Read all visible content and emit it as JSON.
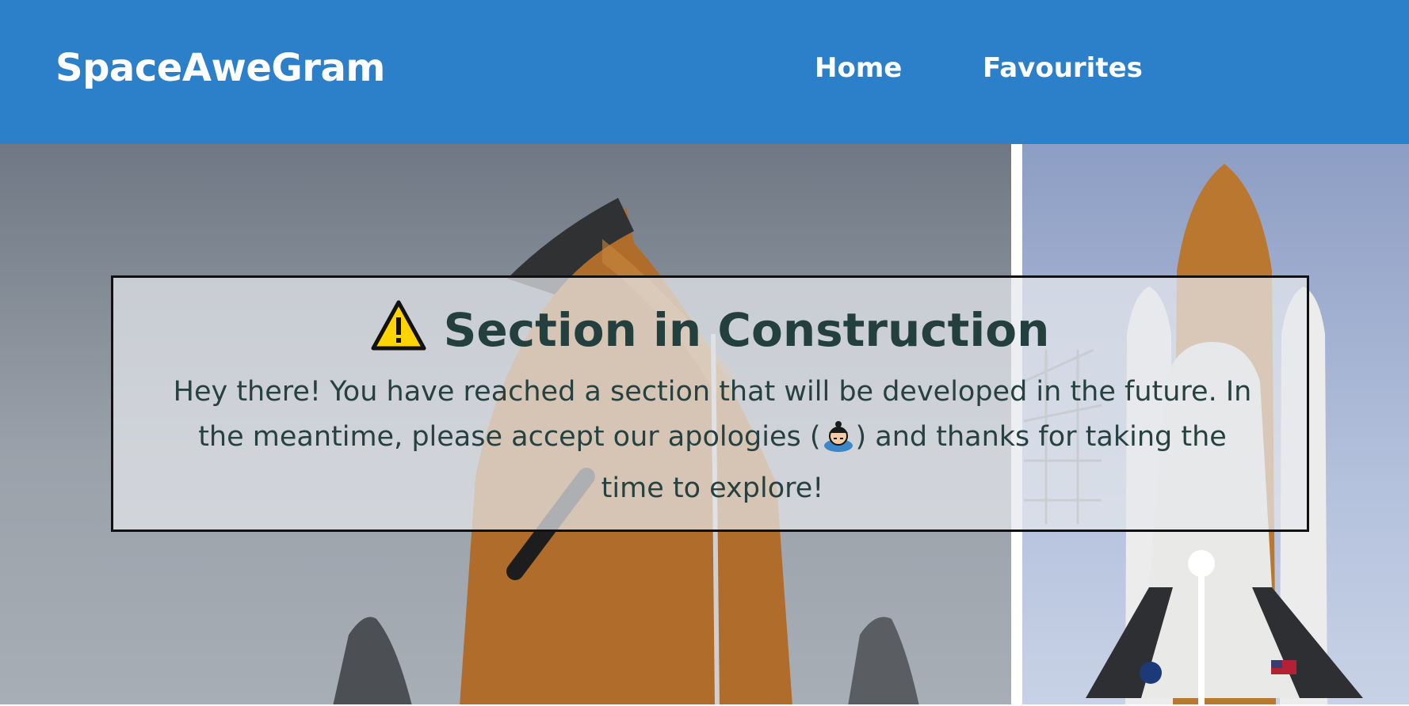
{
  "header": {
    "brand": "SpaceAweGram",
    "nav": {
      "home": "Home",
      "favourites": "Favourites"
    }
  },
  "notice": {
    "title": "Section in Construction",
    "body_before": "Hey there! You have reached a section that will be developed in the future. In the meantime, please accept our apologies (",
    "body_after": ") and thanks for taking the time to explore!",
    "icons": {
      "title": "warning-icon",
      "apology": "bowing-person-icon"
    }
  },
  "hero": {
    "image_subject": "space-shuttle-launch-photos"
  },
  "colors": {
    "header_bg": "#2c7fc9",
    "title_text": "#23403f",
    "body_text": "#26413f"
  }
}
